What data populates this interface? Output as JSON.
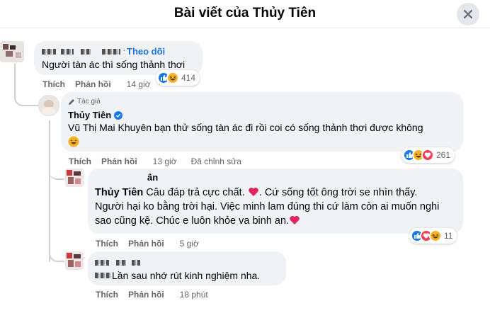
{
  "header": {
    "title": "Bài viết của Thủy Tiên"
  },
  "comments": [
    {
      "name": "",
      "follow": "Theo dõi",
      "text": "Người tàn ác thì sống thảnh thơi",
      "actions": {
        "like": "Thích",
        "reply": "Phản hồi",
        "time": "14 giờ"
      },
      "reactions": {
        "icons": [
          "like-icon",
          "haha-icon"
        ],
        "count": "414"
      }
    },
    {
      "badge": "Tác giả",
      "name": "Thủy Tiên",
      "text": "Vũ Thị Mai Khuyên bạn thử sống tàn ác đi rồi coi có sống thảnh thơi được không",
      "actions": {
        "like": "Thích",
        "reply": "Phản hồi",
        "time": "13 giờ",
        "edited": "Đã chỉnh sửa"
      },
      "reactions": {
        "icons": [
          "like-icon",
          "haha-icon",
          "heart-icon"
        ],
        "count": "261"
      }
    },
    {
      "name_tail": "ân",
      "mention": "Thủy Tiên",
      "text_line1": "Câu đáp trả cực chất.",
      "text_line1b": ". Cứ sống tốt ông trời se nhìn thấy.",
      "text_line2": "Người hại ko bằng trời hại. Việc minh lam đúng thi cứ làm còn ai muốn nghi",
      "text_line3": "sao cũng kệ. Chúc e luôn khỏe va binh an.",
      "actions": {
        "like": "Thích",
        "reply": "Phản hồi",
        "time": "5 giờ"
      },
      "reactions": {
        "icons": [
          "like-icon",
          "heart-icon",
          "haha-icon"
        ],
        "count": "11"
      }
    },
    {
      "text": "Lần sau nhớ rút kinh nghiệm nha.",
      "actions": {
        "like": "Thích",
        "reply": "Phản hồi",
        "time": "18 phút"
      }
    }
  ],
  "colors": {
    "accent": "#1b74e4",
    "bubble": "#f0f2f5",
    "muted": "#65676b"
  }
}
